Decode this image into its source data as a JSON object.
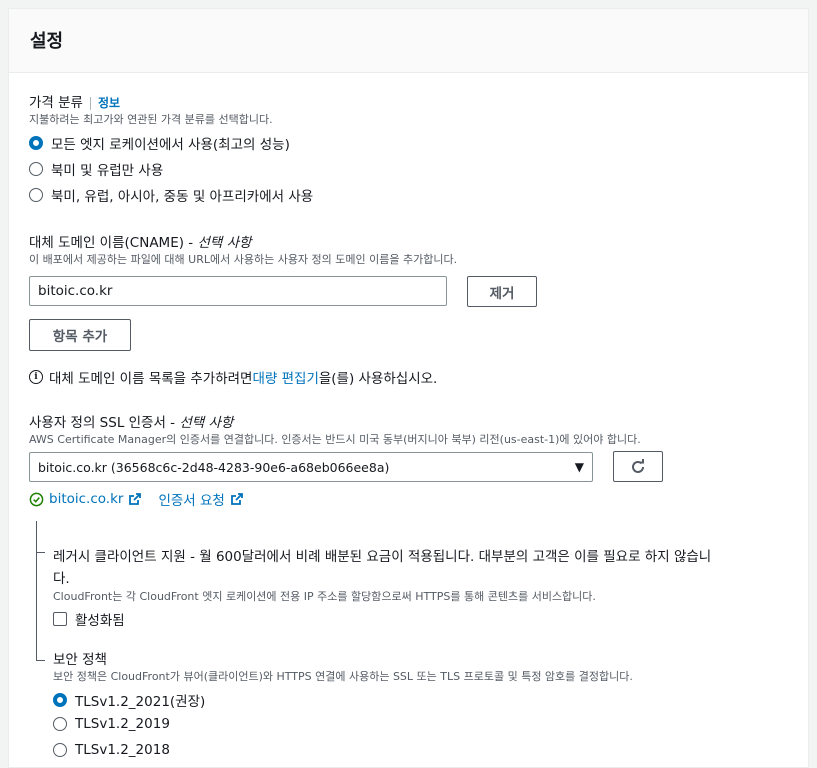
{
  "panel": {
    "title": "설정"
  },
  "price_class": {
    "label": "가격 분류",
    "info_link": "정보",
    "description": "지불하려는 최고가와 연관된 가격 분류를 선택합니다.",
    "options": [
      {
        "label": "모든 엣지 로케이션에서 사용(최고의 성능)",
        "selected": true
      },
      {
        "label": "북미 및 유럽만 사용",
        "selected": false
      },
      {
        "label": "북미, 유럽, 아시아, 중동 및 아프리카에서 사용",
        "selected": false
      }
    ]
  },
  "cname": {
    "label": "대체 도메인 이름(CNAME) - ",
    "optional": "선택 사항",
    "description": "이 배포에서 제공하는 파일에 대해 URL에서 사용하는 사용자 정의 도메인 이름을 추가합니다.",
    "value": "bitoic.co.kr",
    "remove_label": "제거",
    "add_label": "항목 추가",
    "info_prefix": "대체 도메인 이름 목록을 추가하려면 ",
    "info_link": "대량 편집기",
    "info_suffix": "을(를) 사용하십시오."
  },
  "ssl": {
    "label": "사용자 정의 SSL 인증서 - ",
    "optional": "선택 사항",
    "description": "AWS Certificate Manager의 인증서를 연결합니다. 인증서는 반드시 미국 동부(버지니아 북부) 리전(us-east-1)에 있어야 합니다.",
    "selected_cert": "bitoic.co.kr (36568c6c-2d48-4283-90e6-a68eb066ee8a)",
    "cert_link": "bitoic.co.kr",
    "request_link": "인증서 요청"
  },
  "legacy": {
    "title_line1": "레거시 클라이언트 지원 - 월 600달러에서 비례 배분된 요금이 적용됩니다. 대부분의 고객은 이를 필요로 하지 않습니",
    "title_line2": "다.",
    "description": "CloudFront는 각 CloudFront 엣지 로케이션에 전용 IP 주소를 할당함으로써 HTTPS를 통해 콘텐츠를 서비스합니다.",
    "checkbox_label": "활성화됨",
    "checked": false
  },
  "security_policy": {
    "label": "보안 정책",
    "description": "보안 정책은 CloudFront가 뷰어(클라이언트)와 HTTPS 연결에 사용하는 SSL 또는 TLS 프로토콜 및 특정 암호를 결정합니다.",
    "options": [
      {
        "label": "TLSv1.2_2021(권장)",
        "selected": true
      },
      {
        "label": "TLSv1.2_2019",
        "selected": false
      },
      {
        "label": "TLSv1.2_2018",
        "selected": false
      }
    ]
  },
  "colors": {
    "accent": "#0073bb",
    "success": "#1d8102",
    "text": "#16191f",
    "muted": "#545b64"
  }
}
